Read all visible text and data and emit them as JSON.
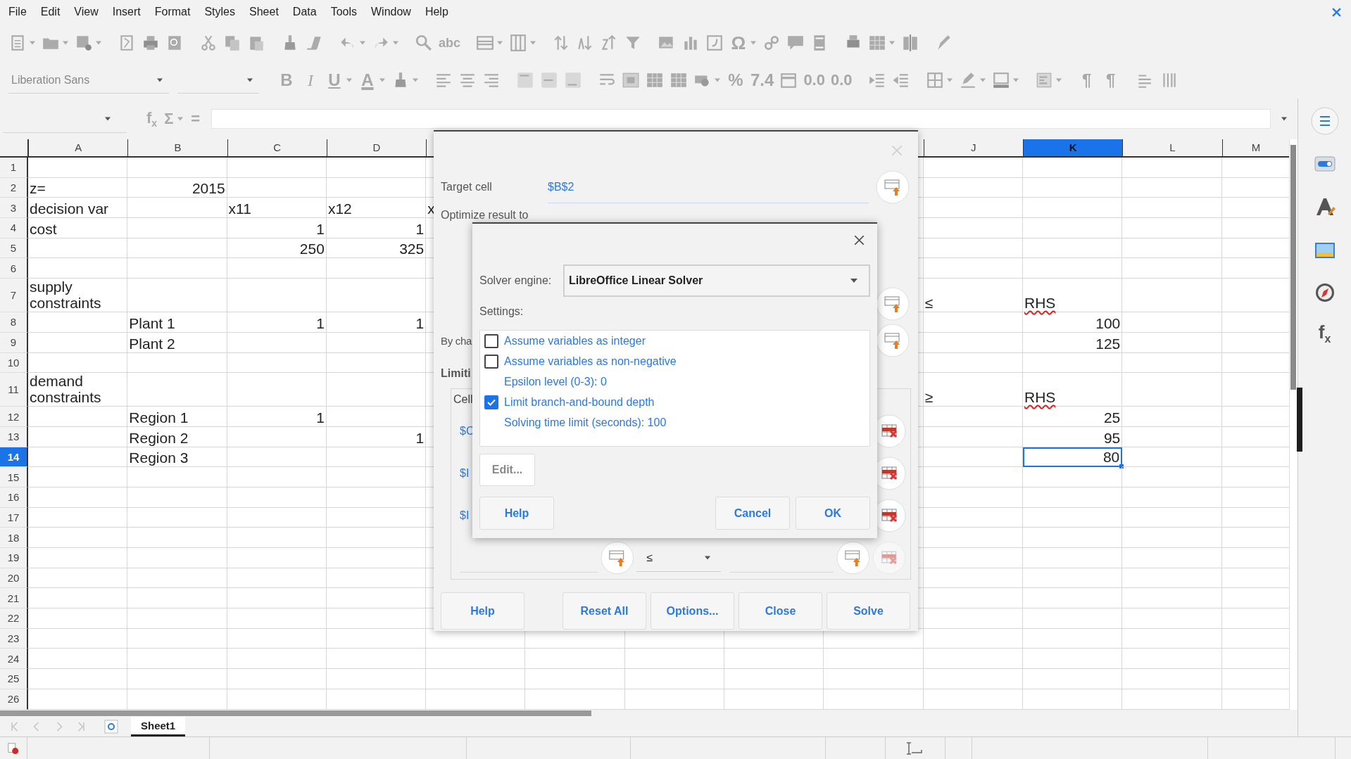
{
  "menu": [
    "File",
    "Edit",
    "View",
    "Insert",
    "Format",
    "Styles",
    "Sheet",
    "Data",
    "Tools",
    "Window",
    "Help"
  ],
  "standard_toolbar": {
    "spelling": "abc",
    "special_character": "Ω"
  },
  "formatting_toolbar": {
    "font_name": "Liberation Sans",
    "bold": "B",
    "italic": "I",
    "underline": "U",
    "font_color": "A",
    "percent": "%",
    "number_format": "7.4",
    "add_decimal": "0.0",
    "delete_decimal": "0.0",
    "left_to_right": "¶",
    "right_to_left": "¶"
  },
  "formula_bar": {
    "function_wizard": "f$_{x}$",
    "sum": "Σ",
    "equals": "="
  },
  "sheet": {
    "columns": [
      {
        "label": "A",
        "selected": false
      },
      {
        "label": "B",
        "selected": false
      },
      {
        "label": "C",
        "selected": false
      },
      {
        "label": "D",
        "selected": false
      },
      {},
      {},
      {},
      {},
      {},
      {
        "label": "J",
        "selected": false
      },
      {
        "label": "K",
        "selected": true
      },
      {
        "label": "L",
        "selected": false
      },
      {
        "label": "M",
        "selected": false
      }
    ],
    "rows": [
      {
        "label": "1",
        "selected": false,
        "cells": {}
      },
      {
        "label": "2",
        "selected": false,
        "cells": {
          "A": {
            "text": "z=",
            "kind": "text",
            "selected": false,
            "misspelled": false
          },
          "B": {
            "text": "2015",
            "kind": "number",
            "selected": false,
            "misspelled": false
          }
        }
      },
      {
        "label": "3",
        "selected": false,
        "cells": {
          "A": {
            "text": "decision var",
            "kind": "text",
            "selected": false,
            "misspelled": false
          },
          "C": {
            "text": "x11",
            "kind": "text",
            "selected": false,
            "misspelled": false
          },
          "D": {
            "text": "x12",
            "kind": "text",
            "selected": false,
            "misspelled": false
          },
          "E": {
            "text": "x",
            "kind": "text",
            "selected": false,
            "misspelled": false
          }
        }
      },
      {
        "label": "4",
        "selected": false,
        "cells": {
          "A": {
            "text": "cost",
            "kind": "text",
            "selected": false,
            "misspelled": false
          },
          "C": {
            "text": "1",
            "kind": "number",
            "selected": false,
            "misspelled": false
          },
          "D": {
            "text": "1",
            "kind": "number",
            "selected": false,
            "misspelled": false
          }
        }
      },
      {
        "label": "5",
        "selected": false,
        "cells": {
          "C": {
            "text": "250",
            "kind": "number",
            "selected": false,
            "misspelled": false
          },
          "D": {
            "text": "325",
            "kind": "number",
            "selected": false,
            "misspelled": false
          }
        }
      },
      {
        "label": "6",
        "selected": false,
        "cells": {}
      },
      {
        "label": "7",
        "selected": false,
        "cells": {
          "A": {
            "text": "supply constraints",
            "kind": "text",
            "selected": false,
            "misspelled": false
          },
          "J": {
            "text": "≤",
            "kind": "text",
            "selected": false,
            "misspelled": false
          },
          "K": {
            "text": "RHS",
            "kind": "text",
            "selected": false,
            "misspelled": true
          }
        }
      },
      {
        "label": "8",
        "selected": false,
        "cells": {
          "B": {
            "text": "Plant 1",
            "kind": "text",
            "selected": false,
            "misspelled": false
          },
          "C": {
            "text": "1",
            "kind": "number",
            "selected": false,
            "misspelled": false
          },
          "D": {
            "text": "1",
            "kind": "number",
            "selected": false,
            "misspelled": false
          },
          "K": {
            "text": "100",
            "kind": "number",
            "selected": false,
            "misspelled": false
          }
        }
      },
      {
        "label": "9",
        "selected": false,
        "cells": {
          "B": {
            "text": "Plant 2",
            "kind": "text",
            "selected": false,
            "misspelled": false
          },
          "K": {
            "text": "125",
            "kind": "number",
            "selected": false,
            "misspelled": false
          }
        }
      },
      {
        "label": "10",
        "selected": false,
        "cells": {}
      },
      {
        "label": "11",
        "selected": false,
        "cells": {
          "A": {
            "text": "demand constraints",
            "kind": "text",
            "selected": false,
            "misspelled": false
          },
          "J": {
            "text": "≥",
            "kind": "text",
            "selected": false,
            "misspelled": false
          },
          "K": {
            "text": "RHS",
            "kind": "text",
            "selected": false,
            "misspelled": true
          }
        }
      },
      {
        "label": "12",
        "selected": false,
        "cells": {
          "B": {
            "text": "Region 1",
            "kind": "text",
            "selected": false,
            "misspelled": false
          },
          "C": {
            "text": "1",
            "kind": "number",
            "selected": false,
            "misspelled": false
          },
          "K": {
            "text": "25",
            "kind": "number",
            "selected": false,
            "misspelled": false
          }
        }
      },
      {
        "label": "13",
        "selected": false,
        "cells": {
          "B": {
            "text": "Region 2",
            "kind": "text",
            "selected": false,
            "misspelled": false
          },
          "D": {
            "text": "1",
            "kind": "number",
            "selected": false,
            "misspelled": false
          },
          "K": {
            "text": "95",
            "kind": "number",
            "selected": false,
            "misspelled": false
          }
        }
      },
      {
        "label": "14",
        "selected": true,
        "cells": {
          "B": {
            "text": "Region 3",
            "kind": "text",
            "selected": false,
            "misspelled": false
          },
          "K": {
            "text": "80",
            "kind": "number",
            "selected": true,
            "misspelled": false
          }
        }
      },
      {
        "label": "15",
        "selected": false,
        "cells": {}
      },
      {
        "label": "16",
        "selected": false,
        "cells": {}
      },
      {
        "label": "17",
        "selected": false,
        "cells": {}
      },
      {
        "label": "18",
        "selected": false,
        "cells": {}
      },
      {
        "label": "19",
        "selected": false,
        "cells": {}
      },
      {
        "label": "20",
        "selected": false,
        "cells": {}
      },
      {
        "label": "21",
        "selected": false,
        "cells": {}
      },
      {
        "label": "22",
        "selected": false,
        "cells": {}
      },
      {
        "label": "23",
        "selected": false,
        "cells": {}
      },
      {
        "label": "24",
        "selected": false,
        "cells": {}
      },
      {
        "label": "25",
        "selected": false,
        "cells": {}
      },
      {
        "label": "26",
        "selected": false,
        "cells": {}
      }
    ]
  },
  "sheet_tabs": [
    {
      "label": "Sheet1",
      "selected": true
    }
  ],
  "sidebar": {
    "functions": "f$_{x}$"
  },
  "solver_dialog": {
    "target_label": "Target cell",
    "target_value": "$B$2",
    "optimize_label": "Optimize result to",
    "changing_label": "By cha",
    "limiting_label": "Limiti",
    "cell_header": "Cell",
    "constraints": [
      {
        "cell": "$C",
        "removable": true
      },
      {
        "cell": "$I",
        "removable": true
      },
      {
        "cell": "$I",
        "removable": true
      }
    ],
    "new_constraint": {
      "operator": "≤",
      "removable": false
    },
    "buttons": [
      "Help",
      "Reset All",
      "Options...",
      "Close",
      "Solve"
    ]
  },
  "options_dialog": {
    "engine_label": "Solver engine:",
    "engine": "LibreOffice Linear Solver",
    "settings_label": "Settings:",
    "settings": [
      {
        "label": "Assume variables as integer",
        "kind": "checkbox",
        "checked": false
      },
      {
        "label": "Assume variables as non-negative",
        "kind": "checkbox",
        "checked": false
      },
      {
        "label": "Epsilon level (0-3): 0",
        "kind": "value"
      },
      {
        "label": "Limit branch-and-bound depth",
        "kind": "checkbox",
        "checked": true
      },
      {
        "label": "Solving time limit (seconds): 100",
        "kind": "value"
      }
    ],
    "edit_button": {
      "label": "Edit...",
      "disabled": true
    },
    "buttons": [
      "Help",
      "Cancel",
      "OK"
    ]
  }
}
